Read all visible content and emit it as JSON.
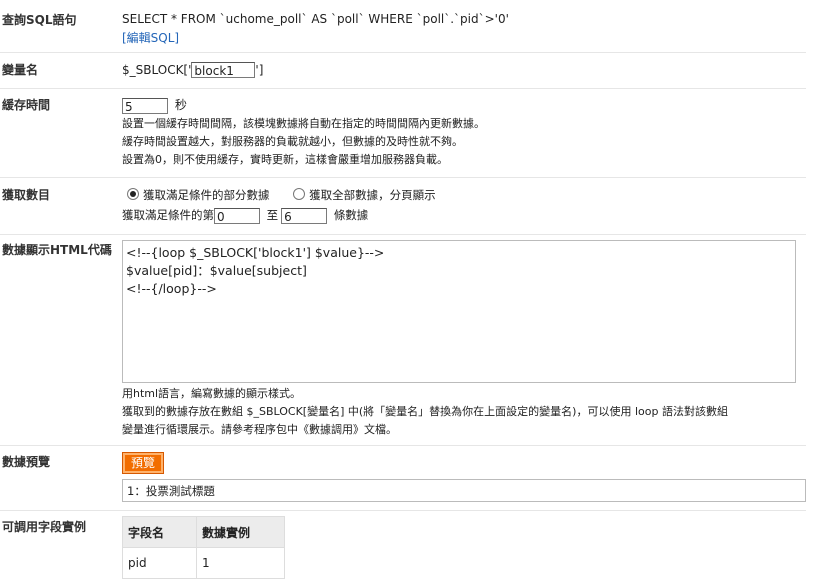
{
  "query": {
    "label": "查詢SQL語句",
    "sql": "SELECT * FROM `uchome_poll` AS `poll` WHERE `poll`.`pid`>'0'",
    "edit_link": "[編輯SQL]"
  },
  "variable": {
    "label": "變量名",
    "prefix": "$_SBLOCK['",
    "value": "block1",
    "suffix": "']"
  },
  "cache": {
    "label": "緩存時間",
    "value": "5",
    "unit": "秒",
    "help": [
      "設置一個緩存時間間隔，該模塊數據將自動在指定的時間間隔內更新數據。",
      "緩存時間設置越大，對服務器的負載就越小，但數據的及時性就不夠。",
      "設置為0，則不使用緩存，實時更新，這樣會嚴重增加服務器負載。"
    ]
  },
  "fetch": {
    "label": "獲取數目",
    "option_partial": "獲取滿足條件的部分數據",
    "option_all": "獲取全部數據，分頁顯示",
    "selected": "partial",
    "range_prefix": "獲取滿足條件的第",
    "range_start": "0",
    "range_mid": "至",
    "range_end": "6",
    "range_suffix": "條數據"
  },
  "template": {
    "label": "數據顯示HTML代碼",
    "lines": [
      "<!--{loop $_SBLOCK['block1'] $value}-->",
      "$value[pid]：$value[subject]",
      "<!--{/loop}-->"
    ],
    "help": [
      "用html語言，編寫數據的顯示樣式。",
      "獲取到的數據存放在數組 $_SBLOCK[變量名] 中(將「變量名」替換為你在上面設定的變量名)，可以使用 loop 語法對該數組",
      "變量進行循環展示。請參考程序包中《數據調用》文檔。"
    ]
  },
  "preview": {
    "label": "數據預覽",
    "button": "預覽",
    "result": "1：投票測試標題"
  },
  "fields": {
    "label": "可調用字段實例",
    "headers": [
      "字段名",
      "數據實例"
    ],
    "rows": [
      [
        "pid",
        "1"
      ]
    ]
  },
  "colors": {
    "accent_button": "#f26d00",
    "link": "#2466b8"
  }
}
